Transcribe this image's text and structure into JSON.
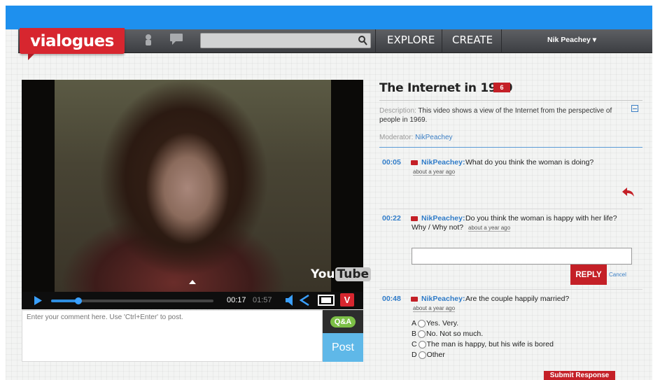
{
  "header": {
    "logo": "vialogues",
    "search_placeholder": "",
    "nav": {
      "explore": "EXPLORE",
      "create": "CREATE"
    },
    "user_menu": "Nik Peachey ▾"
  },
  "player": {
    "watermark_you": "You",
    "watermark_tube": "Tube",
    "current_time": "00:17",
    "total_time": "01:57",
    "progress_fraction": 0.17,
    "v_badge": "V"
  },
  "composer": {
    "placeholder": "Enter your comment here. Use 'Ctrl+Enter' to post.",
    "qa_label": "Q&A",
    "post_label": "Post"
  },
  "vialogue": {
    "title": "The Internet in 1969",
    "badge": "6",
    "description_label": "Description:",
    "description": "This video shows a view of the Internet from the perspective of people in 1969.",
    "moderator_label": "Moderator:",
    "moderator": "NikPeachey"
  },
  "comments": [
    {
      "time": "00:05",
      "user": "NikPeachey:",
      "text": "What do you think the woman is doing?",
      "ago": "about a year ago"
    },
    {
      "time": "00:22",
      "user": "NikPeachey:",
      "text": "Do you think the woman is happy with her life? Why / Why not?",
      "ago": "about a year ago"
    },
    {
      "time": "00:48",
      "user": "NikPeachey:",
      "text": "Are the couple happily married?",
      "ago": "about a year ago"
    }
  ],
  "reply": {
    "button": "REPLY",
    "cancel": "Cancel"
  },
  "poll": {
    "options": [
      {
        "letter": "A",
        "text": "Yes. Very."
      },
      {
        "letter": "B",
        "text": "No. Not so much."
      },
      {
        "letter": "C",
        "text": "The man is happy, but his wife is bored"
      },
      {
        "letter": "D",
        "text": "Other"
      }
    ],
    "submit": "Submit Response"
  },
  "colors": {
    "brand_red": "#d7262f",
    "link_blue": "#2f7bc8",
    "top_bar_blue": "#1e90ee",
    "nav_dark": "#3c3e42"
  }
}
